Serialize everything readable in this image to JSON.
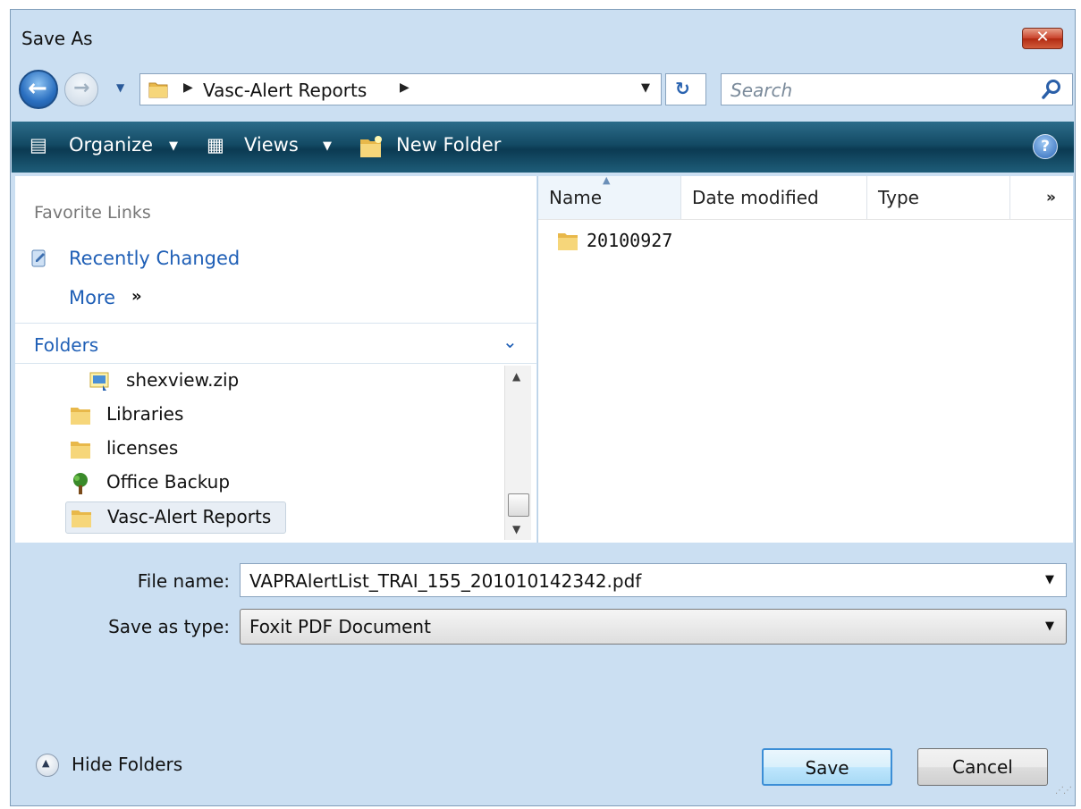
{
  "window": {
    "title": "Save As",
    "close_glyph": "✕"
  },
  "nav": {
    "back_icon": "back-arrow-icon",
    "forward_icon": "forward-arrow-icon",
    "address_path": "Vasc-Alert Reports",
    "search_placeholder": "Search"
  },
  "toolbar": {
    "organize_label": "Organize",
    "views_label": "Views",
    "new_folder_label": "New Folder",
    "help_label": "?"
  },
  "sidebar": {
    "favorite_links_heading": "Favorite Links",
    "recently_changed_label": "Recently Changed",
    "more_label": "More",
    "folders_label": "Folders",
    "tree": [
      {
        "label": "shexview.zip",
        "icon": "zip-file-icon"
      },
      {
        "label": "Libraries",
        "icon": "folder-icon"
      },
      {
        "label": "licenses",
        "icon": "folder-icon"
      },
      {
        "label": "Office Backup",
        "icon": "tree-icon"
      },
      {
        "label": "Vasc-Alert Reports",
        "icon": "folder-icon",
        "selected": true
      }
    ]
  },
  "file_list": {
    "columns": [
      "Name",
      "Date modified",
      "Type"
    ],
    "more_columns_glyph": "»",
    "items": [
      {
        "name": "20100927",
        "icon": "folder-icon"
      }
    ]
  },
  "form": {
    "file_name_label": "File name:",
    "file_name_value": "VAPRAlertList_TRAI_155_201010142342.pdf",
    "save_type_label": "Save as type:",
    "save_type_value": "Foxit PDF Document"
  },
  "footer": {
    "hide_folders_label": "Hide Folders",
    "save_label": "Save",
    "cancel_label": "Cancel"
  },
  "colors": {
    "toolbar": "#134a64",
    "link": "#1f5fb6",
    "window_frame": "#cbdff2"
  }
}
